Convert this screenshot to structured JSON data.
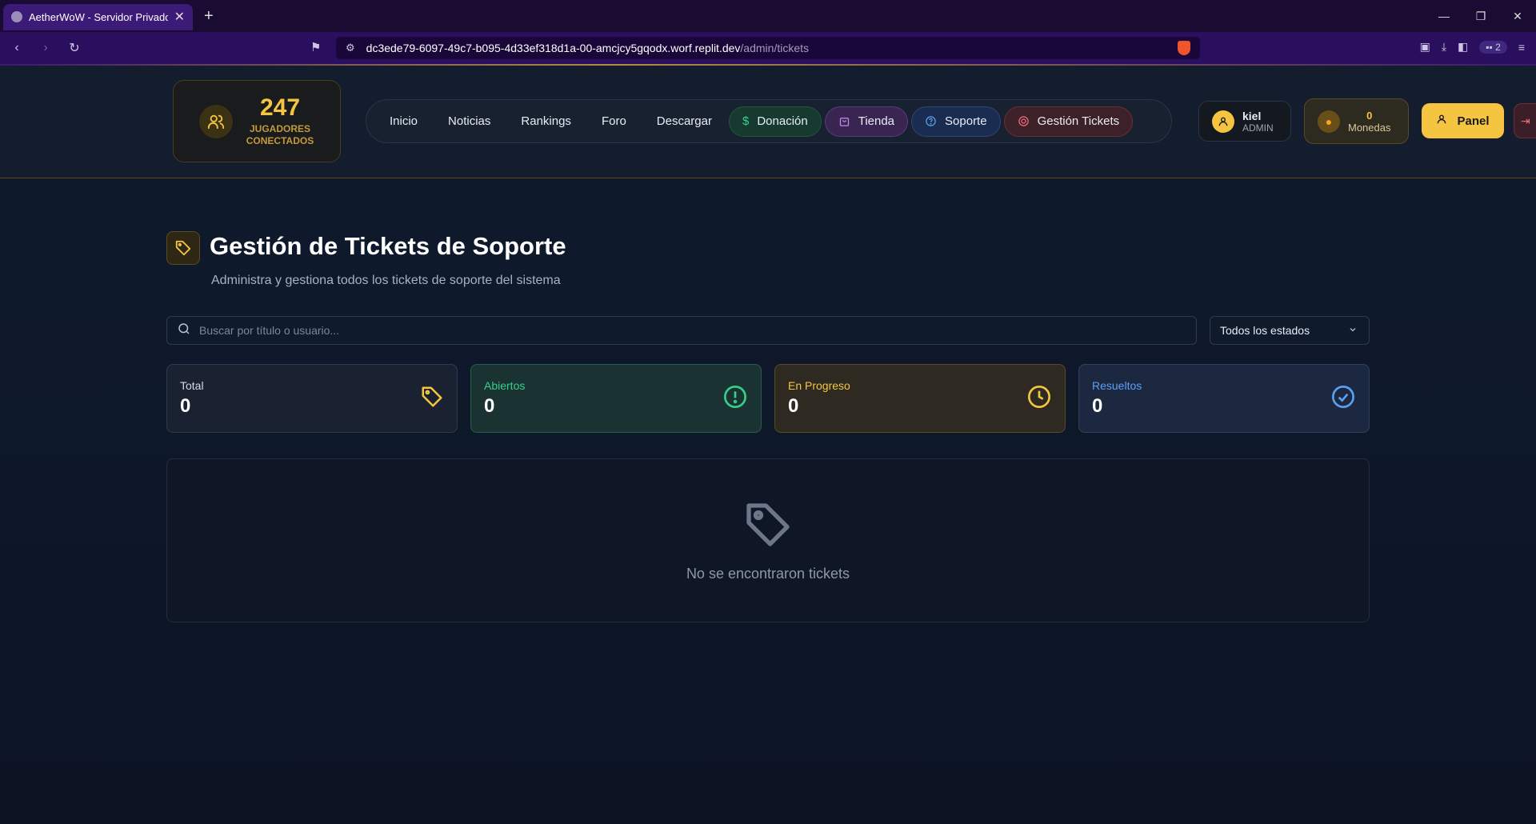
{
  "browser": {
    "tab_title": "AetherWoW - Servidor Privado W",
    "url_host": "dc3ede79-6097-49c7-b095-4d33ef318d1a-00-amcjcy5gqodx.worf.replit.dev",
    "url_path": "/admin/tickets",
    "extensions_count": "2"
  },
  "header": {
    "players_count": "247",
    "players_label": "JUGADORES CONECTADOS",
    "nav": {
      "inicio": "Inicio",
      "noticias": "Noticias",
      "rankings": "Rankings",
      "foro": "Foro",
      "descargar": "Descargar",
      "donacion": "Donación",
      "tienda": "Tienda",
      "soporte": "Soporte",
      "gestion": "Gestión Tickets"
    },
    "user_name": "kiel",
    "user_role": "ADMIN",
    "coins_value": "0",
    "coins_label": "Monedas",
    "panel_label": "Panel"
  },
  "page": {
    "title": "Gestión de Tickets de Soporte",
    "subtitle": "Administra y gestiona todos los tickets de soporte del sistema",
    "search_placeholder": "Buscar por título o usuario...",
    "status_filter": "Todos los estados",
    "stats": {
      "total_label": "Total",
      "total_value": "0",
      "open_label": "Abiertos",
      "open_value": "0",
      "progress_label": "En Progreso",
      "progress_value": "0",
      "resolved_label": "Resueltos",
      "resolved_value": "0"
    },
    "empty_message": "No se encontraron tickets"
  },
  "colors": {
    "accent": "#f5c542",
    "green": "#35d08a",
    "blue": "#5c9ff3",
    "red": "#f36a7c",
    "purple": "#c48cf2"
  },
  "icons": [
    "users-icon",
    "dollar-icon",
    "shopping-bag-icon",
    "help-circle-icon",
    "lifebuoy-icon",
    "user-icon",
    "money-bag-icon",
    "logout-icon",
    "tag-icon",
    "search-icon",
    "chevron-down-icon",
    "alert-circle-icon",
    "clock-icon",
    "check-circle-icon"
  ]
}
